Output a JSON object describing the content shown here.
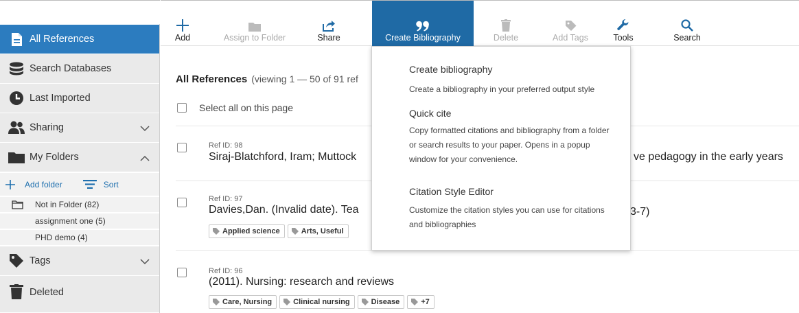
{
  "colors": {
    "accent": "#2c7cbf",
    "toolbar_active": "#1f6aa5",
    "sidebar_bg": "#eaeaea",
    "icon": "#333333",
    "tool_icon": "#1f6aa5",
    "disabled": "#bbbbbb"
  },
  "sidebar": {
    "items": [
      {
        "label": "All References",
        "icon": "document-icon",
        "active": true
      },
      {
        "label": "Search Databases",
        "icon": "database-icon"
      },
      {
        "label": "Last Imported",
        "icon": "clock-icon"
      },
      {
        "label": "Sharing",
        "icon": "users-icon",
        "expand": "chevron-down-icon"
      },
      {
        "label": "My Folders",
        "icon": "folder-icon",
        "expand": "chevron-up-icon"
      },
      {
        "label": "Tags",
        "icon": "tag-icon",
        "expand": "chevron-down-icon"
      },
      {
        "label": "Deleted",
        "icon": "trash-icon"
      }
    ],
    "add_folder": "Add folder",
    "sort": "Sort",
    "folders": [
      {
        "label": "Not in Folder (82)"
      },
      {
        "label": "assignment one (5)"
      },
      {
        "label": "PHD demo (4)"
      }
    ]
  },
  "toolbar": {
    "add": "Add",
    "assign": "Assign to Folder",
    "share": "Share",
    "bibliography": "Create Bibliography",
    "delete": "Delete",
    "add_tags": "Add Tags",
    "tools": "Tools",
    "search": "Search"
  },
  "main": {
    "heading": "All References",
    "viewing": "(viewing 1 — 50 of 91 ref",
    "select_all": "Select all on this page",
    "references": [
      {
        "ref_id": "Ref ID: 98",
        "title": "Siraj-Blatchford, Iram; Muttock",
        "title_tail": "ve pedagogy in the early years",
        "tags": []
      },
      {
        "ref_id": "Ref ID: 97",
        "title": "Davies,Dan. (Invalid date). Tea",
        "title_tail": "3-7)",
        "tags": [
          "Applied science",
          "Arts, Useful"
        ]
      },
      {
        "ref_id": "Ref ID: 96",
        "title": "(2011). Nursing: research and reviews",
        "title_tail": "",
        "tags": [
          "Care, Nursing",
          "Clinical nursing",
          "Disease",
          "+7"
        ]
      }
    ]
  },
  "dropdown": {
    "items": [
      {
        "title": "Create bibliography",
        "desc": "Create a bibliography in your preferred output style"
      },
      {
        "title": "Quick cite",
        "desc": "Copy formatted citations and bibliography from a folder or search results to your paper. Opens in a popup window for your convenience."
      },
      {
        "title": "Citation Style Editor",
        "desc": "Customize the citation styles you can use for citations and bibliographies"
      }
    ]
  }
}
